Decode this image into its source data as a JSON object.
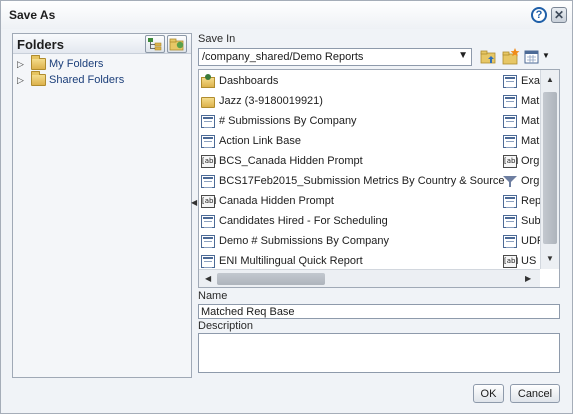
{
  "dialog": {
    "title": "Save As",
    "help_glyph": "?",
    "close_glyph": "✕"
  },
  "folders": {
    "title": "Folders",
    "items": [
      {
        "label": "My Folders",
        "icon": "folder-icon"
      },
      {
        "label": "Shared Folders",
        "icon": "folder-icon"
      }
    ]
  },
  "save_in": {
    "label": "Save In",
    "path": "/company_shared/Demo Reports"
  },
  "file_list": {
    "col1": [
      {
        "label": "Dashboards",
        "icon": "dashboard-folder-icon"
      },
      {
        "label": "Jazz (3-9180019921)",
        "icon": "folder-icon"
      },
      {
        "label": "# Submissions By Company",
        "icon": "report-icon"
      },
      {
        "label": "Action Link Base",
        "icon": "report-icon"
      },
      {
        "label": "BCS_Canada Hidden Prompt",
        "icon": "prompt-icon"
      },
      {
        "label": "BCS17Feb2015_Submission Metrics By Country & Source",
        "icon": "report-icon"
      },
      {
        "label": "Canada Hidden Prompt",
        "icon": "prompt-icon"
      },
      {
        "label": "Candidates Hired - For Scheduling",
        "icon": "report-icon"
      },
      {
        "label": "Demo # Submissions By Company",
        "icon": "report-icon"
      },
      {
        "label": "ENI Multilingual Quick Report",
        "icon": "report-icon"
      }
    ],
    "col2": [
      {
        "label": "Exa",
        "icon": "report-icon"
      },
      {
        "label": "Mat",
        "icon": "report-icon"
      },
      {
        "label": "Mat",
        "icon": "report-icon"
      },
      {
        "label": "Mat",
        "icon": "report-icon"
      },
      {
        "label": "Org",
        "icon": "prompt-icon"
      },
      {
        "label": "Org",
        "icon": "filter-icon"
      },
      {
        "label": "Rep",
        "icon": "report-icon"
      },
      {
        "label": "Sub",
        "icon": "report-icon"
      },
      {
        "label": "UDF",
        "icon": "report-icon"
      },
      {
        "label": "US I",
        "icon": "prompt-icon"
      }
    ],
    "prompt_glyph": "[ab]"
  },
  "name": {
    "label": "Name",
    "value": "Matched Req Base"
  },
  "description": {
    "label": "Description",
    "value": ""
  },
  "buttons": {
    "ok": "OK",
    "cancel": "Cancel"
  }
}
